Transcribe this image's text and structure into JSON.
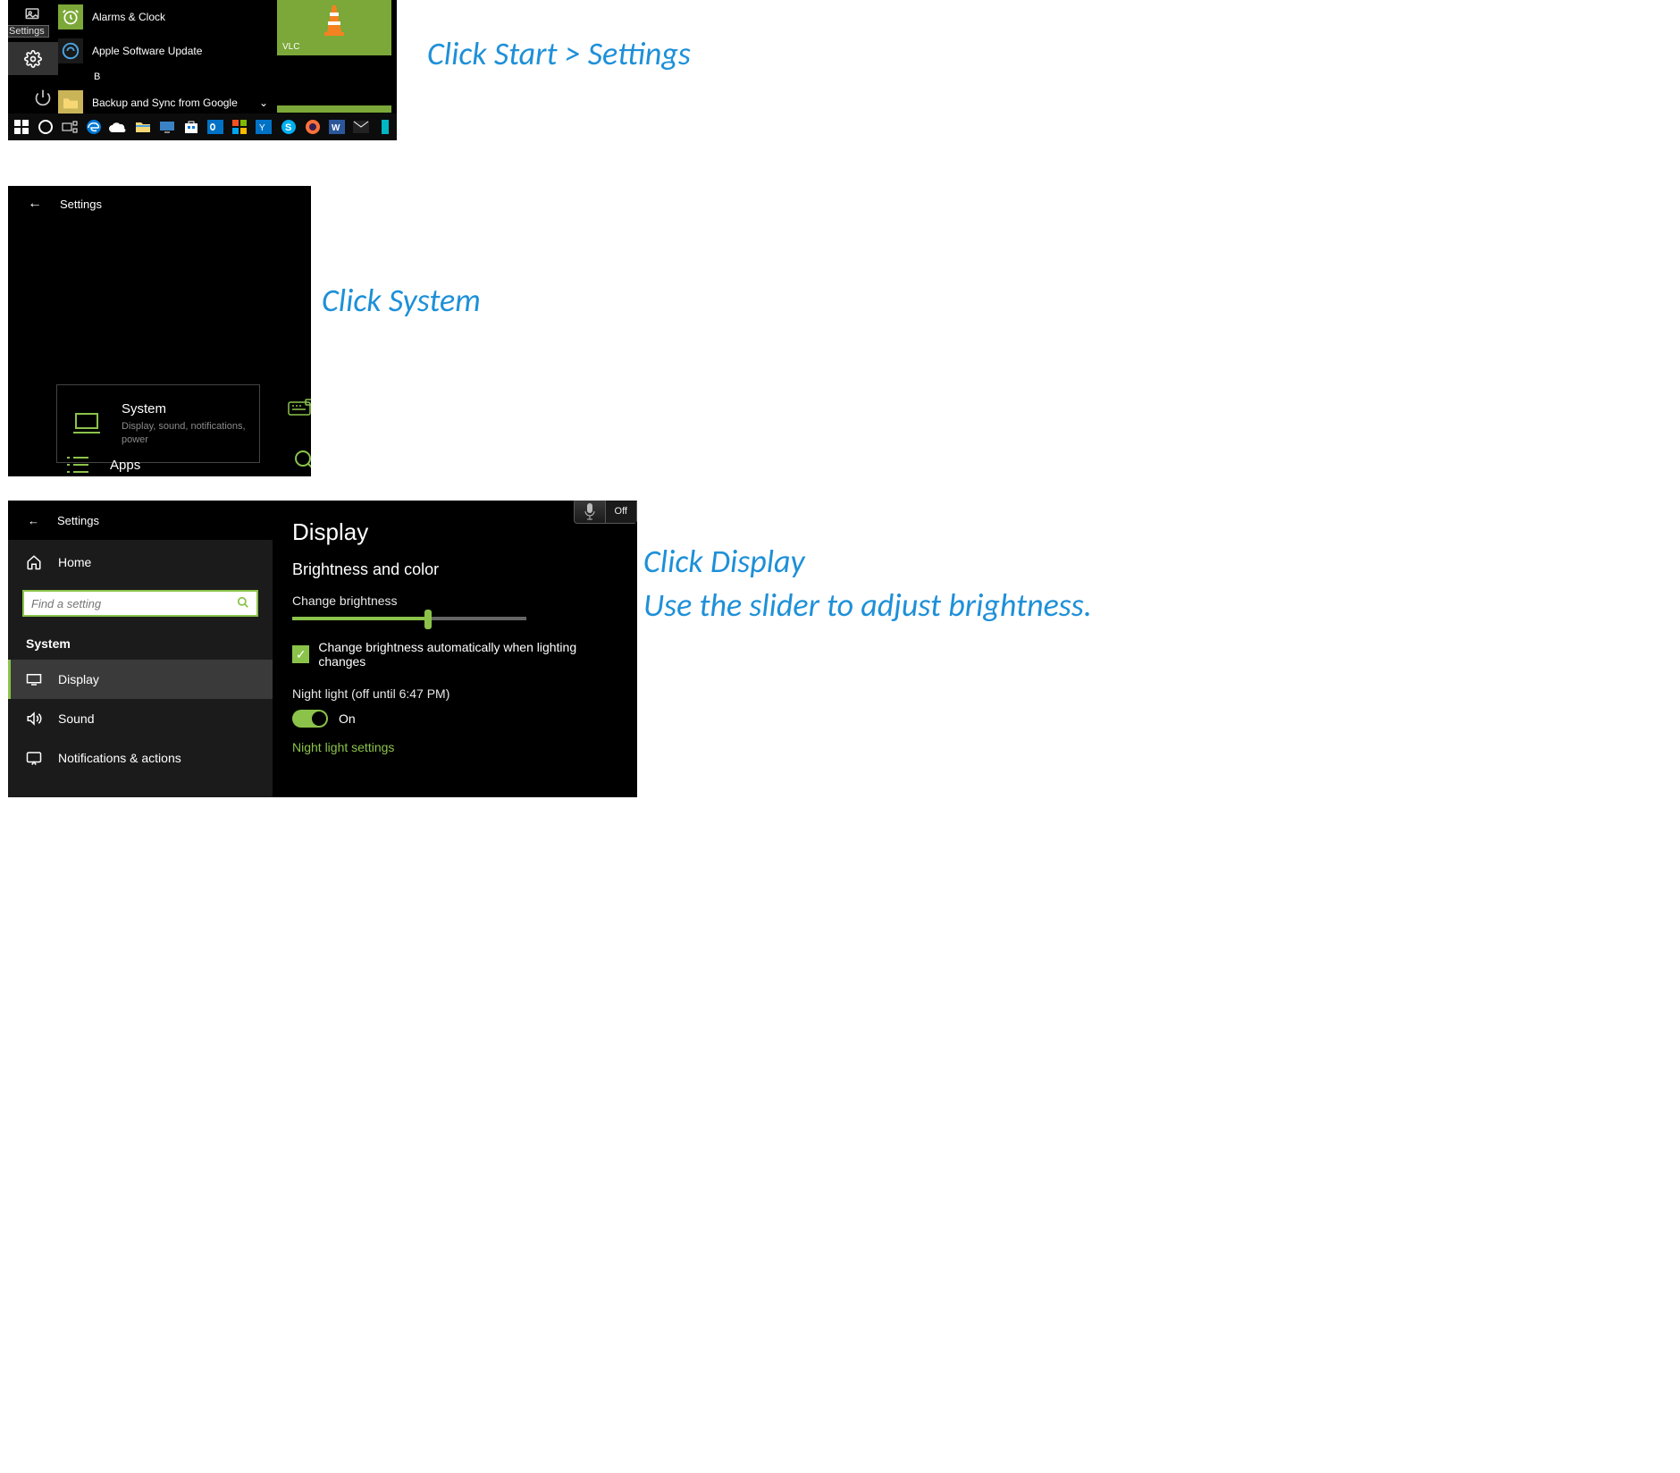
{
  "captions": {
    "c1": "Click Start > Settings",
    "c2": "Click System",
    "c3": "Click Display\nUse the slider to adjust brightness."
  },
  "sec1": {
    "tooltip": "Settings",
    "apps": {
      "alarms": "Alarms & Clock",
      "apple": "Apple Software Update",
      "section_letter": "B",
      "backup": "Backup and Sync from Google"
    },
    "tile_vlc": "VLC"
  },
  "sec2": {
    "header": "Settings",
    "system": {
      "title": "System",
      "sub": "Display, sound, notifications, power"
    },
    "apps_title": "Apps"
  },
  "sec3": {
    "header": "Settings",
    "home": "Home",
    "search_placeholder": "Find a setting",
    "category": "System",
    "items": {
      "display": "Display",
      "sound": "Sound",
      "notifications": "Notifications & actions"
    },
    "page_title": "Display",
    "section_heading": "Brightness and color",
    "brightness_label": "Change brightness",
    "auto_brightness": "Change brightness automatically when lighting changes",
    "night_light_label": "Night light (off until 6:47 PM)",
    "toggle_state": "On",
    "night_light_link": "Night light settings",
    "mic_off": "Off"
  }
}
